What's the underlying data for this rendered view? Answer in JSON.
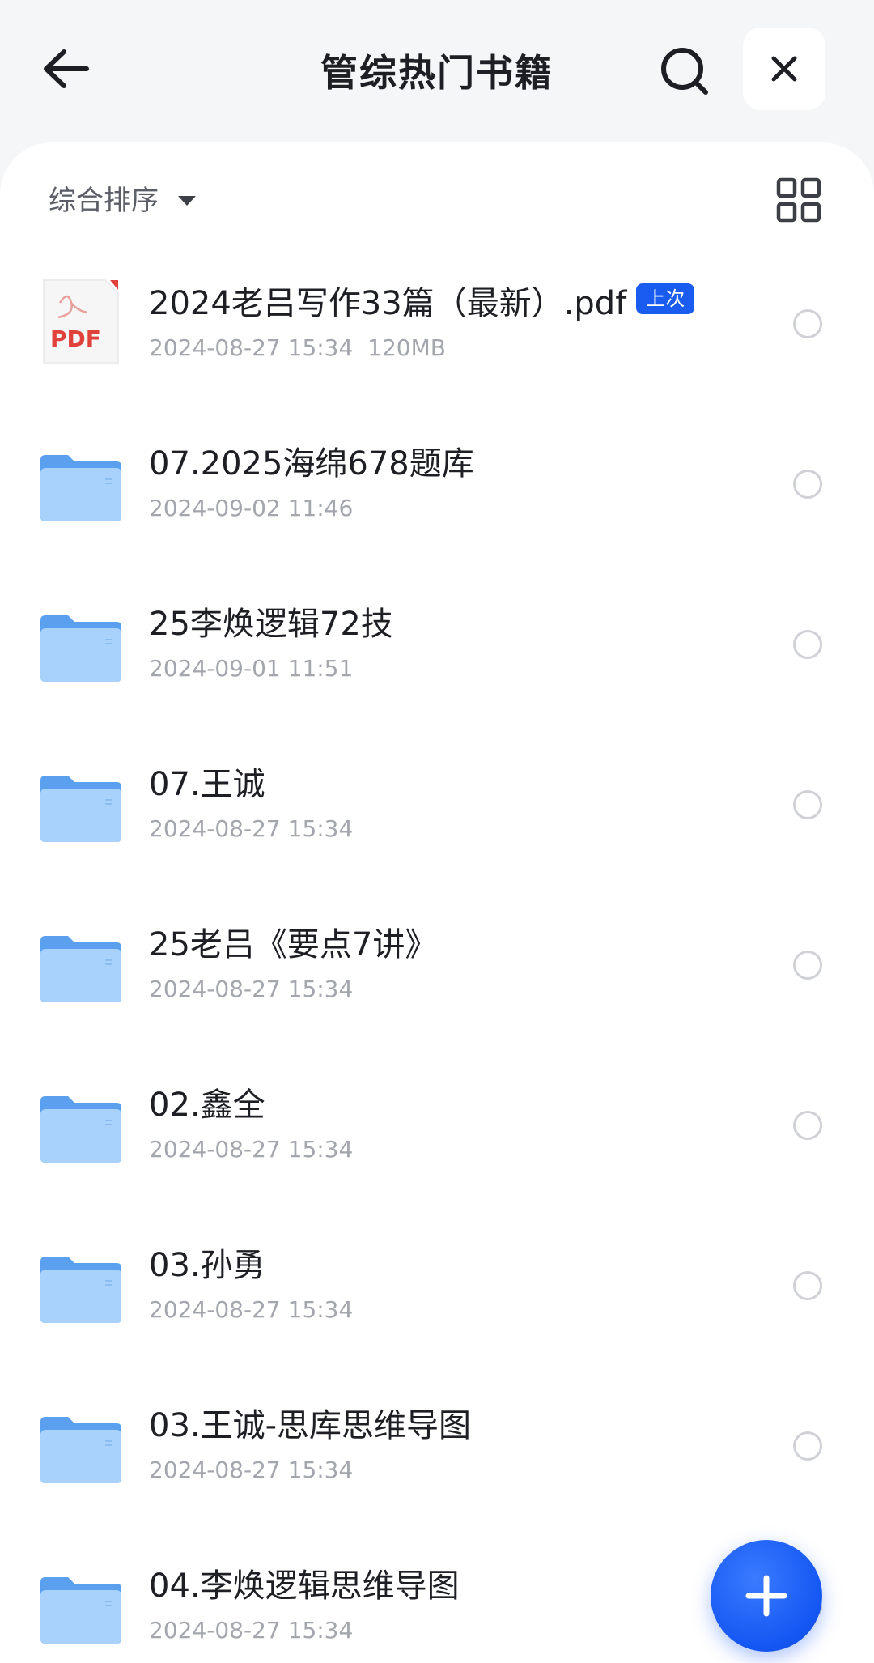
{
  "header": {
    "title": "管综热门书籍",
    "back_icon": "arrow-left-icon",
    "search_icon": "search-icon",
    "close_icon": "close-icon"
  },
  "toolbar": {
    "sort_label": "综合排序",
    "sort_icon": "caret-down-icon",
    "view_icon": "grid-view-icon"
  },
  "files": [
    {
      "type": "pdf",
      "name": "2024老吕写作33篇（最新）.pdf",
      "date": "2024-08-27 15:34",
      "size": "120MB",
      "badge": "上次",
      "pdf_label": "PDF"
    },
    {
      "type": "folder",
      "name": "07.2025海绵678题库",
      "date": "2024-09-02 11:46"
    },
    {
      "type": "folder",
      "name": "25李焕逻辑72技",
      "date": "2024-09-01 11:51"
    },
    {
      "type": "folder",
      "name": "07.王诚",
      "date": "2024-08-27 15:34"
    },
    {
      "type": "folder",
      "name": "25老吕《要点7讲》",
      "date": "2024-08-27 15:34"
    },
    {
      "type": "folder",
      "name": "02.鑫全",
      "date": "2024-08-27 15:34"
    },
    {
      "type": "folder",
      "name": "03.孙勇",
      "date": "2024-08-27 15:34"
    },
    {
      "type": "folder",
      "name": "03.王诚-思库思维导图",
      "date": "2024-08-27 15:34"
    },
    {
      "type": "folder",
      "name": "04.李焕逻辑思维导图",
      "date": "2024-08-27 15:34"
    }
  ],
  "fab": {
    "icon": "plus-icon"
  },
  "colors": {
    "accent": "#1a5cf0",
    "folder": "#7bb8f4",
    "pdf_red": "#e0413a",
    "meta_text": "#a3a6ad"
  }
}
